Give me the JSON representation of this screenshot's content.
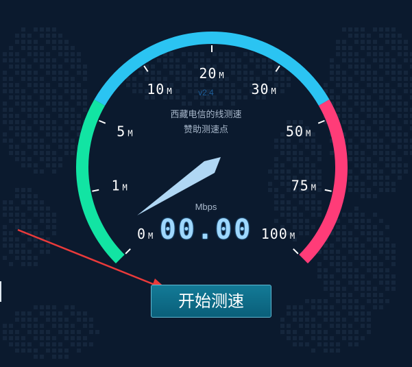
{
  "gauge": {
    "version": "v2.4",
    "info_line1": "西藏电信的线测速",
    "info_line2": "赞助测速点",
    "unit": "Mbps",
    "speed": "00.00",
    "ticks": [
      {
        "value": "0",
        "unit": "M"
      },
      {
        "value": "1",
        "unit": "M"
      },
      {
        "value": "5",
        "unit": "M"
      },
      {
        "value": "10",
        "unit": "M"
      },
      {
        "value": "20",
        "unit": "M"
      },
      {
        "value": "30",
        "unit": "M"
      },
      {
        "value": "50",
        "unit": "M"
      },
      {
        "value": "75",
        "unit": "M"
      },
      {
        "value": "100",
        "unit": "M"
      }
    ],
    "colors": {
      "low": "#12e4a3",
      "mid": "#2bc4f2",
      "high": "#ff3c78",
      "needle": "#b9e2ff"
    }
  },
  "button": {
    "label": "开始测速"
  },
  "annotation": {
    "arrow_color": "#ea3a3a"
  }
}
